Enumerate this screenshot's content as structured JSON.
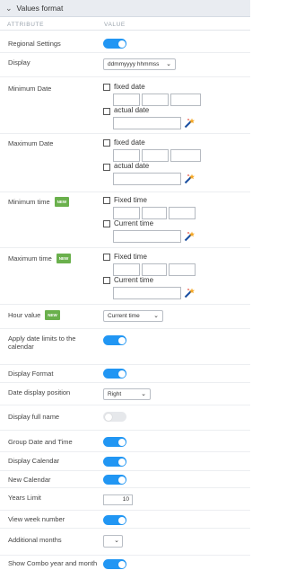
{
  "panel": {
    "title": "Values format"
  },
  "columns": {
    "attribute": "ATTRIBUTE",
    "value": "VALUE"
  },
  "rows": {
    "regional_settings": {
      "label": "Regional Settings",
      "on": true
    },
    "display": {
      "label": "Display",
      "selected": "ddmmyyyy hhmmss"
    },
    "minimum_date": {
      "label": "Minimum Date",
      "fixed": "fixed date",
      "actual": "actual date"
    },
    "maximum_date": {
      "label": "Maximum Date",
      "fixed": "fixed date",
      "actual": "actual date"
    },
    "minimum_time": {
      "label": "Minimum time",
      "badge": "NEW",
      "fixed": "Fixed time",
      "current": "Current time"
    },
    "maximum_time": {
      "label": "Maximum time",
      "badge": "NEW",
      "fixed": "Fixed time",
      "current": "Current time"
    },
    "hour_value": {
      "label": "Hour value",
      "badge": "NEW",
      "selected": "Current time"
    },
    "apply_date_limits": {
      "label": "Apply date limits to the calendar",
      "on": true
    },
    "display_format": {
      "label": "Display Format",
      "on": true
    },
    "date_display_position": {
      "label": "Date display position",
      "selected": "Right"
    },
    "display_full_name": {
      "label": "Display full name",
      "on": false
    },
    "group_date_time": {
      "label": "Group Date and Time",
      "on": true
    },
    "display_calendar": {
      "label": "Display Calendar",
      "on": true
    },
    "new_calendar": {
      "label": "New Calendar",
      "on": true
    },
    "years_limit": {
      "label": "Years Limit",
      "value": "10"
    },
    "view_week_number": {
      "label": "View week number",
      "on": true
    },
    "additional_months": {
      "label": "Additional months",
      "selected": ""
    },
    "show_combo": {
      "label": "Show Combo year and month",
      "on": true
    }
  },
  "colors": {
    "toggle_on": "#2196f3",
    "toggle_off": "#e6e8eb",
    "badge": "#6ab04c",
    "header_bg": "#e9ecf1"
  },
  "icons": {
    "panel_toggle": "chevron-down-icon",
    "picker": "magic-wand-icon"
  }
}
